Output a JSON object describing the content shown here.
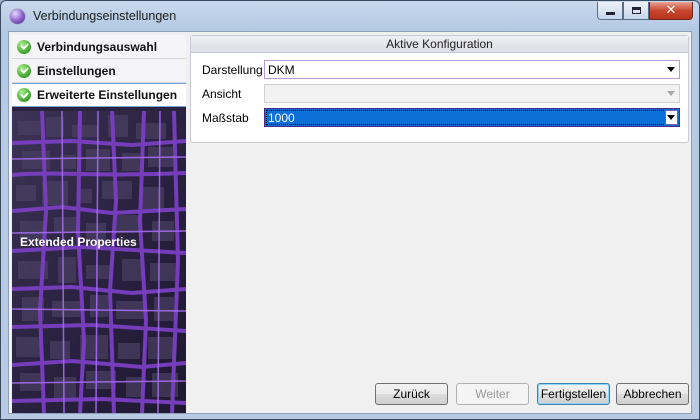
{
  "window": {
    "title": "Verbindungseinstellungen"
  },
  "sidebar": {
    "items": [
      {
        "label": "Verbindungsauswahl"
      },
      {
        "label": "Einstellungen"
      },
      {
        "label": "Erweiterte Einstellungen"
      }
    ],
    "caption": "Extended Properties"
  },
  "panel": {
    "header": "Aktive Konfiguration",
    "rows": [
      {
        "label": "Darstellung",
        "value": "DKM"
      },
      {
        "label": "Ansicht",
        "value": ""
      },
      {
        "label": "Maßstab",
        "value": "1000"
      }
    ]
  },
  "footer": {
    "back": "Zurück",
    "next": "Weiter",
    "finish": "Fertigstellen",
    "cancel": "Abbrechen"
  },
  "icons": {
    "app": "app-orb-icon",
    "check": "check-circle-icon"
  },
  "colors": {
    "sidebar_bg": "#2c2340",
    "city_lines": "#7a3fc2",
    "selection": "#0a6fd6",
    "check_green": "#3aa12a"
  }
}
